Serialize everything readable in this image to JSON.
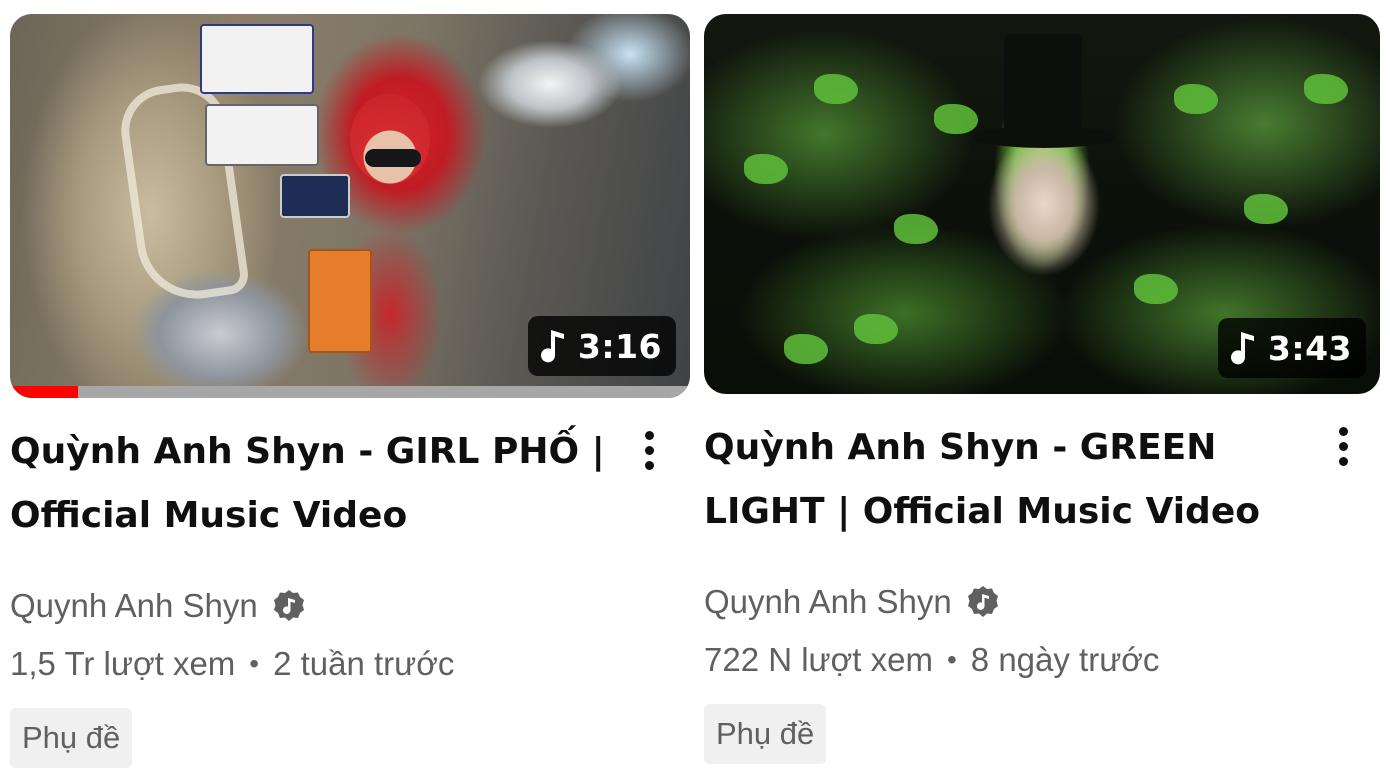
{
  "videos": [
    {
      "title": "Quỳnh Anh Shyn - GIRL PHỐ | Official Music Video",
      "duration": "3:16",
      "channel": "Quynh Anh Shyn",
      "views": "1,5 Tr lượt xem",
      "separator": "•",
      "age": "2 tuần trước",
      "badge": "Phụ đề",
      "watch_progress": 0.1
    },
    {
      "title": "Quỳnh Anh Shyn - GREEN LIGHT | Official Music Video",
      "duration": "3:43",
      "channel": "Quynh Anh Shyn",
      "views": "722 N lượt xem",
      "separator": "•",
      "age": "8 ngày trước",
      "badge": "Phụ đề",
      "watch_progress": 0
    }
  ],
  "icons": {
    "duration_icon": "music-note-icon",
    "verified_icon": "verified-artist-icon",
    "menu_icon": "more-vert-icon"
  },
  "colors": {
    "progress": "#ff0000",
    "title": "#0f0f0f",
    "meta": "#606060",
    "badge_bg": "#f0f0f0"
  }
}
